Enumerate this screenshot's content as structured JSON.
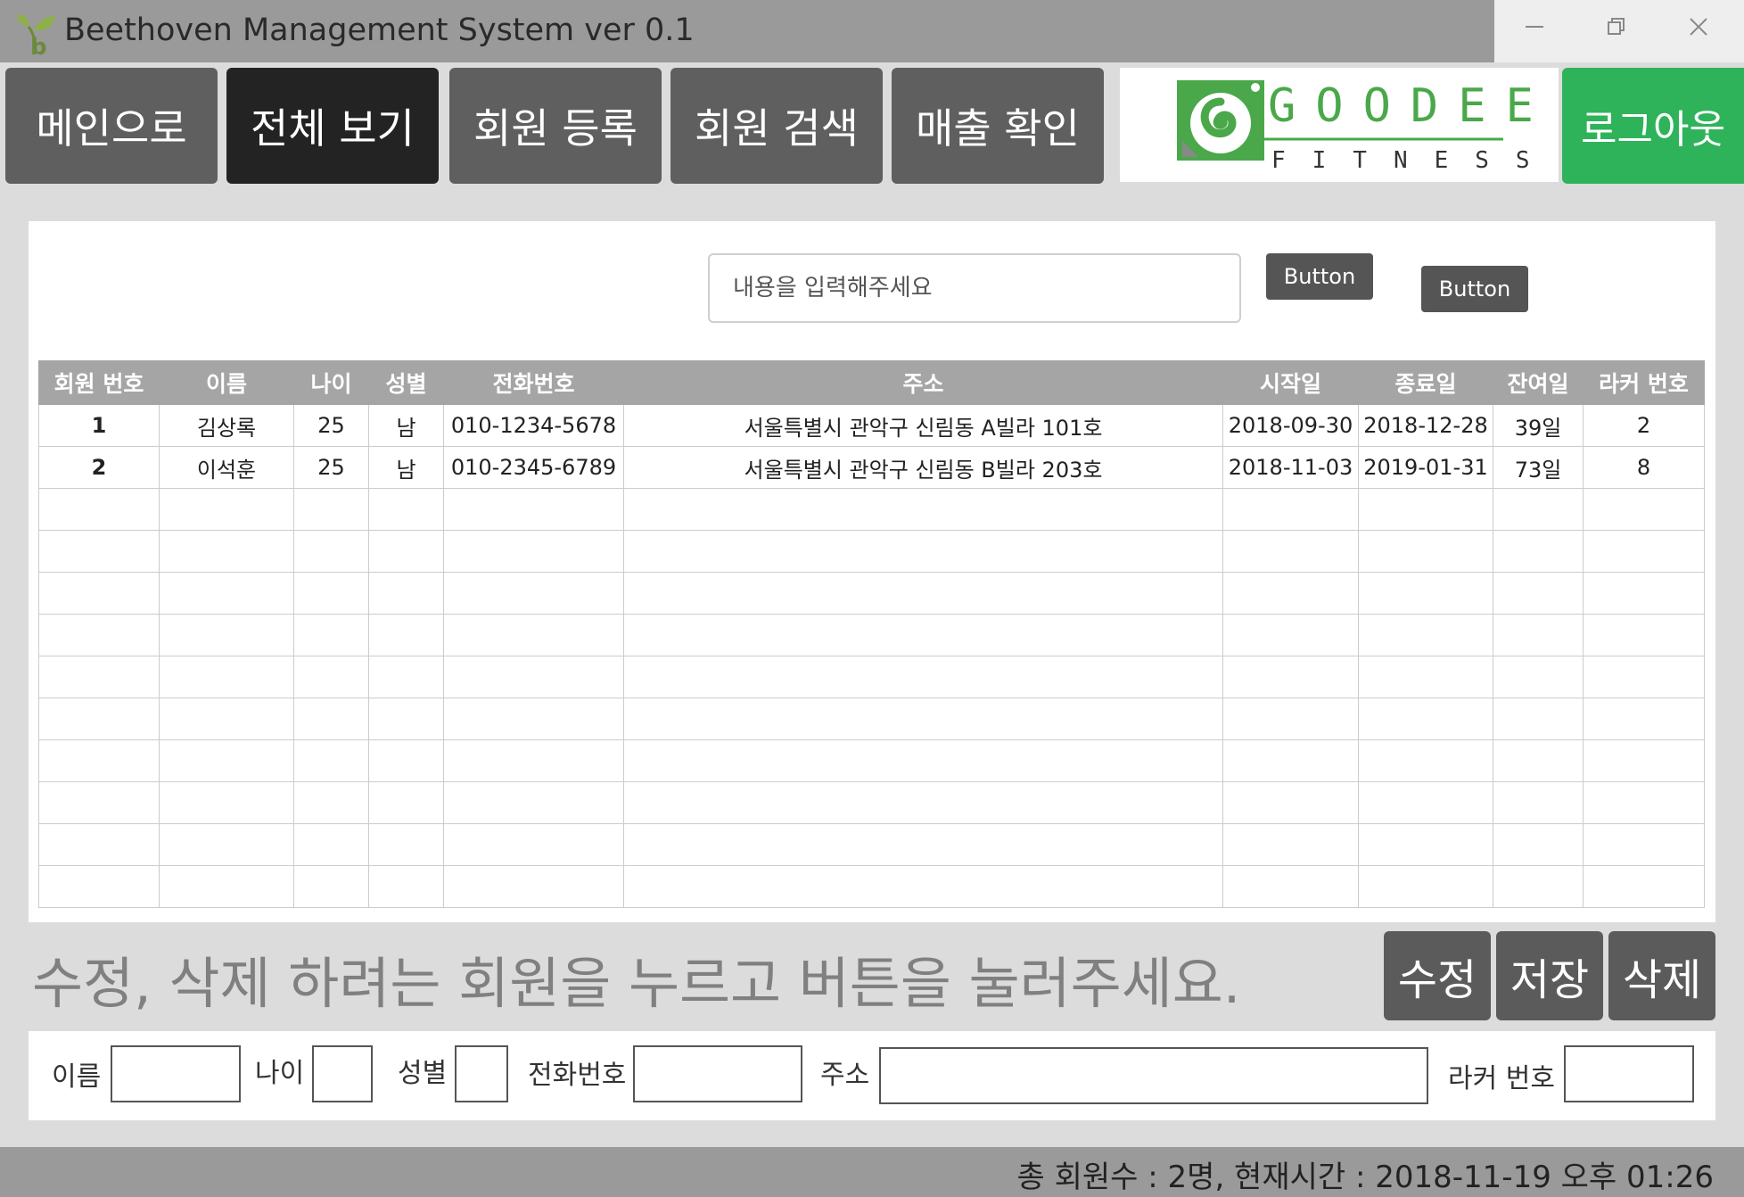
{
  "window": {
    "title": "Beethoven Management System ver 0.1",
    "icon": "sprout-b-icon",
    "controls": [
      "minimize-icon",
      "restore-icon",
      "close-icon"
    ]
  },
  "nav": {
    "items": [
      {
        "label": "메인으로",
        "active": false
      },
      {
        "label": "전체 보기",
        "active": true
      },
      {
        "label": "회원 등록",
        "active": false
      },
      {
        "label": "회원 검색",
        "active": false
      },
      {
        "label": "매출 확인",
        "active": false
      }
    ],
    "logout_label": "로그아웃"
  },
  "logo": {
    "line1": "GOODEE",
    "line2": "FITNESS"
  },
  "search": {
    "placeholder": "내용을 입력해주세요",
    "button1_label": "Button",
    "button2_label": "Button"
  },
  "table": {
    "headers": [
      "회원 번호",
      "이름",
      "나이",
      "성별",
      "전화번호",
      "주소",
      "시작일",
      "종료일",
      "잔여일",
      "라커 번호"
    ],
    "rows": [
      [
        "1",
        "김상록",
        "25",
        "남",
        "010-1234-5678",
        "서울특별시 관악구 신림동 A빌라 101호",
        "2018-09-30",
        "2018-12-28",
        "39일",
        "2"
      ],
      [
        "2",
        "이석훈",
        "25",
        "남",
        "010-2345-6789",
        "서울특별시 관악구 신림동 B빌라 203호",
        "2018-11-03",
        "2019-01-31",
        "73일",
        "8"
      ]
    ]
  },
  "instruction": "수정, 삭제 하려는 회원을 누르고 버튼을 눌러주세요.",
  "actions": {
    "edit_label": "수정",
    "save_label": "저장",
    "delete_label": "삭제"
  },
  "form": {
    "name_label": "이름",
    "age_label": "나이",
    "gender_label": "성별",
    "phone_label": "전화번호",
    "address_label": "주소",
    "locker_label": "라커 번호"
  },
  "status": "총 회원수 : 2명, 현재시간 : 2018-11-19 오후 01:26",
  "colors": {
    "titlebar": "#9a9a9a",
    "nav_button": "#5f5f5f",
    "nav_active": "#232323",
    "logout": "#2fb35a",
    "logo_green": "#4aa84a",
    "table_header": "#a5a5a5"
  }
}
